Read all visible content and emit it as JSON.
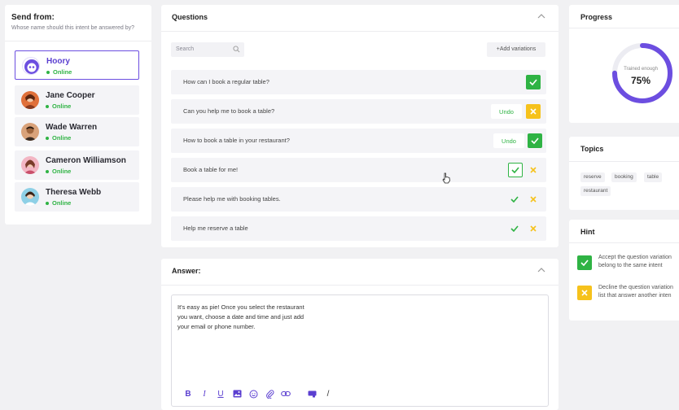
{
  "send_from": {
    "title": "Send from:",
    "subtitle": "Whose name should this intent be answered by?",
    "senders": [
      {
        "name": "Hoory",
        "status": "Online",
        "active": true
      },
      {
        "name": "Jane Cooper",
        "status": "Online"
      },
      {
        "name": "Wade Warren",
        "status": "Online"
      },
      {
        "name": "Cameron Williamson",
        "status": "Online"
      },
      {
        "name": "Theresa Webb",
        "status": "Online"
      }
    ]
  },
  "questions": {
    "title": "Questions",
    "search_placeholder": "Search",
    "add_variations": "+Add variations",
    "undo_label": "Undo",
    "rows": [
      {
        "text": "How can I book a regular table?"
      },
      {
        "text": "Can you help me to book a table?"
      },
      {
        "text": "How to book a table in your restaurant?"
      },
      {
        "text": "Book a table for me!"
      },
      {
        "text": "Please help me with booking tables."
      },
      {
        "text": "Help me reserve a table"
      }
    ]
  },
  "answer": {
    "title": "Answer:",
    "lines": [
      "It's easy as pie! Once you select the restaurant",
      "you want, choose a date and time and just add",
      "your email or phone number."
    ],
    "toolbar_glyphs": {
      "bold": "B",
      "italic": "I",
      "underline": "U",
      "slash": "/"
    }
  },
  "progress": {
    "title": "Progress",
    "label": "Trained enough",
    "value": "75%",
    "fraction": 0.75
  },
  "topics": {
    "title": "Topics",
    "tags": [
      "reserve",
      "booking",
      "table",
      "restaurant"
    ]
  },
  "hint": {
    "title": "Hint",
    "accept_lines": [
      "Accept the question variation",
      "belong to the same intent"
    ],
    "decline_lines": [
      "Decline the question variation",
      "list that answer another inten"
    ]
  },
  "colors": {
    "accent": "#6c4ee0",
    "online": "#2fb344",
    "accept": "#2fb344",
    "decline": "#f6c21c"
  }
}
